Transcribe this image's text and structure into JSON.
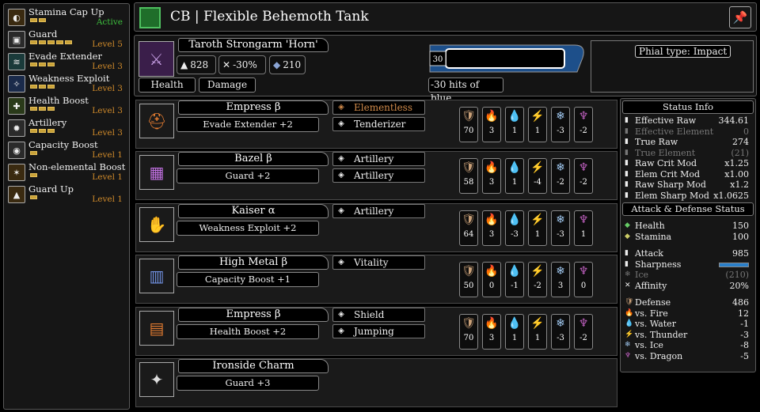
{
  "skills": [
    {
      "name": "Stamina Cap Up",
      "level": "Active",
      "pips": 2,
      "max": 2,
      "active": true,
      "icon": "stamina-icon"
    },
    {
      "name": "Guard",
      "level": "Level 5",
      "pips": 5,
      "max": 5,
      "icon": "shield-icon"
    },
    {
      "name": "Evade Extender",
      "level": "Level 3",
      "pips": 3,
      "max": 3,
      "icon": "evade-icon"
    },
    {
      "name": "Weakness Exploit",
      "level": "Level 3",
      "pips": 3,
      "max": 3,
      "icon": "weakness-icon"
    },
    {
      "name": "Health Boost",
      "level": "Level 3",
      "pips": 3,
      "max": 3,
      "icon": "health-icon"
    },
    {
      "name": "Artillery",
      "level": "Level 3",
      "pips": 3,
      "max": 3,
      "icon": "artillery-icon"
    },
    {
      "name": "Capacity Boost",
      "level": "Level 1",
      "pips": 1,
      "max": 1,
      "icon": "capacity-icon"
    },
    {
      "name": "Non-elemental Boost",
      "level": "Level 1",
      "pips": 1,
      "max": 1,
      "icon": "nonelemental-icon"
    },
    {
      "name": "Guard Up",
      "level": "Level 1",
      "pips": 1,
      "max": 1,
      "icon": "guard-up-icon"
    }
  ],
  "header": {
    "title": "CB | Flexible Behemoth Tank"
  },
  "weapon": {
    "name": "Taroth Strongarm 'Horn'",
    "attack": "828",
    "affinity": "-30%",
    "defense": "210",
    "health_btn": "Health",
    "damage_btn": "Damage",
    "sharp_level": "30",
    "hits_text": "-30 hits of blue",
    "phial": "Phial type: Impact"
  },
  "armor": [
    {
      "name": "Empress β",
      "skill": "Evade Extender +2",
      "decos": [
        {
          "name": "Elementless",
          "color": "#d08a4a"
        },
        {
          "name": "Tenderizer",
          "color": "#eee"
        }
      ],
      "res": [
        "70",
        "3",
        "1",
        "1",
        "-3",
        "-2"
      ],
      "icon": "helm-icon",
      "iconColor": "#e07a30"
    },
    {
      "name": "Bazel β",
      "skill": "Guard +2",
      "decos": [
        {
          "name": "Artillery",
          "color": "#eee"
        },
        {
          "name": "Artillery",
          "color": "#eee"
        }
      ],
      "res": [
        "58",
        "3",
        "1",
        "-4",
        "-2",
        "-2"
      ],
      "icon": "chest-icon",
      "iconColor": "#c070e0"
    },
    {
      "name": "Kaiser α",
      "skill": "Weakness Exploit +2",
      "decos": [
        {
          "name": "Artillery",
          "color": "#eee"
        }
      ],
      "res": [
        "64",
        "3",
        "-3",
        "1",
        "-3",
        "1"
      ],
      "icon": "gauntlet-icon",
      "iconColor": "#e07a30"
    },
    {
      "name": "High Metal β",
      "skill": "Capacity Boost +1",
      "decos": [
        {
          "name": "Vitality",
          "color": "#eee"
        }
      ],
      "res": [
        "50",
        "0",
        "-1",
        "-2",
        "3",
        "0"
      ],
      "icon": "waist-icon",
      "iconColor": "#7090e0"
    },
    {
      "name": "Empress β",
      "skill": "Health Boost +2",
      "decos": [
        {
          "name": "Shield",
          "color": "#eee"
        },
        {
          "name": "Jumping",
          "color": "#eee"
        }
      ],
      "res": [
        "70",
        "3",
        "1",
        "1",
        "-3",
        "-2"
      ],
      "icon": "legs-icon",
      "iconColor": "#e07a30"
    }
  ],
  "charm": {
    "name": "Ironside Charm",
    "skill": "Guard +3"
  },
  "status": {
    "title1": "Status Info",
    "info": [
      {
        "label": "Effective Raw",
        "value": "344.61"
      },
      {
        "label": "Effective Element",
        "value": "0",
        "dim": true
      },
      {
        "label": "True Raw",
        "value": "274"
      },
      {
        "label": "True Element",
        "value": "(21)",
        "dim": true
      },
      {
        "label": "Raw Crit Mod",
        "value": "x1.25"
      },
      {
        "label": "Elem Crit Mod",
        "value": "x1.00"
      },
      {
        "label": "Raw Sharp Mod",
        "value": "x1.2"
      },
      {
        "label": "Elem Sharp Mod",
        "value": "x1.0625"
      }
    ],
    "title2": "Attack & Defense Status",
    "health": {
      "label": "Health",
      "value": "150"
    },
    "stamina": {
      "label": "Stamina",
      "value": "100"
    },
    "attack": {
      "label": "Attack",
      "value": "985"
    },
    "sharpness": {
      "label": "Sharpness"
    },
    "ice_el": {
      "label": "Ice",
      "value": "(210)"
    },
    "affinity": {
      "label": "Affinity",
      "value": "20%"
    },
    "defense": [
      {
        "label": "Defense",
        "value": "486"
      },
      {
        "label": "vs. Fire",
        "value": "12"
      },
      {
        "label": "vs. Water",
        "value": "-1"
      },
      {
        "label": "vs. Thunder",
        "value": "-3"
      },
      {
        "label": "vs. Ice",
        "value": "-8"
      },
      {
        "label": "vs. Dragon",
        "value": "-5"
      }
    ]
  }
}
